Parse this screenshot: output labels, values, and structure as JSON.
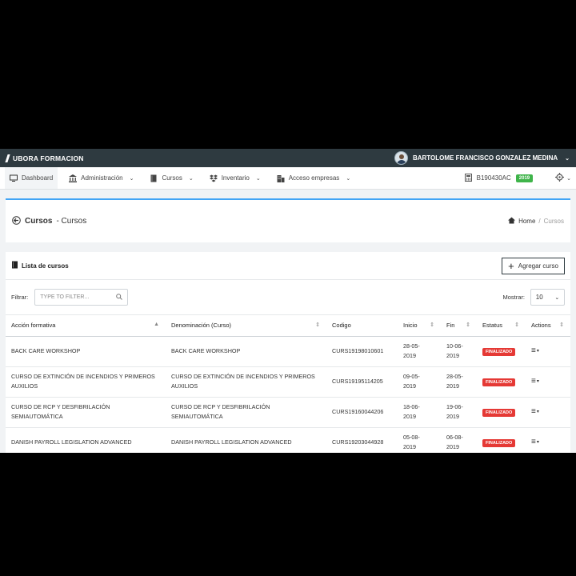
{
  "app": {
    "brand": "UBORA FORMACION",
    "user_name": "BARTOLOME FRANCISCO GONZALEZ MEDINA"
  },
  "nav": {
    "items": [
      {
        "label": "Dashboard",
        "icon": "monitor-icon",
        "chevron": false
      },
      {
        "label": "Administración",
        "icon": "bank-icon",
        "chevron": true
      },
      {
        "label": "Cursos",
        "icon": "book-icon",
        "chevron": true
      },
      {
        "label": "Inventario",
        "icon": "dropbox-icon",
        "chevron": true
      },
      {
        "label": "Acceso empresas",
        "icon": "building-icon",
        "chevron": true
      }
    ],
    "code": "B190430AC",
    "year": "2019"
  },
  "header": {
    "title_bold": "Cursos",
    "title_rest": "- Cursos",
    "breadcrumb_home": "Home",
    "breadcrumb_sep": "/",
    "breadcrumb_current": "Cursos"
  },
  "list": {
    "title": "Lista de cursos",
    "add_label": "Agregar curso",
    "filter_label": "Filtrar:",
    "filter_placeholder": "TYPE TO FILTER...",
    "show_label": "Mostrar:",
    "show_value": "10",
    "columns": [
      "Acción formativa",
      "Denominación (Curso)",
      "Codigo",
      "Inicio",
      "Fin",
      "Estatus",
      "Actions"
    ],
    "rows": [
      {
        "accion": "BACK CARE WORKSHOP",
        "denominacion": "BACK CARE WORKSHOP",
        "codigo": "CURS19198010601",
        "inicio_a": "28-05-",
        "inicio_b": "2019",
        "fin_a": "10-06-",
        "fin_b": "2019",
        "estatus": "FINALIZADO"
      },
      {
        "accion": "CURSO DE EXTINCIÓN DE INCENDIOS Y PRIMEROS AUXILIOS",
        "denominacion": "CURSO DE EXTINCIÓN DE INCENDIOS Y PRIMEROS AUXILIOS",
        "codigo": "CURS19195114205",
        "inicio_a": "09-05-",
        "inicio_b": "2019",
        "fin_a": "28-05-",
        "fin_b": "2019",
        "estatus": "FINALIZADO"
      },
      {
        "accion": "CURSO DE RCP Y DESFIBRILACIÓN SEMIAUTOMÁTICA",
        "denominacion": "CURSO DE RCP Y DESFIBRILACIÓN SEMIAUTOMÁTICA",
        "codigo": "CURS19160044206",
        "inicio_a": "18-06-",
        "inicio_b": "2019",
        "fin_a": "19-06-",
        "fin_b": "2019",
        "estatus": "FINALIZADO"
      },
      {
        "accion": "DANISH PAYROLL LEGISLATION ADVANCED",
        "denominacion": "DANISH PAYROLL LEGISLATION ADVANCED",
        "codigo": "CURS19203044928",
        "inicio_a": "05-08-",
        "inicio_b": "2019",
        "fin_a": "06-08-",
        "fin_b": "2019",
        "estatus": "FINALIZADO"
      }
    ]
  },
  "colors": {
    "topbar": "#2e3a40",
    "accent": "#42a5f5",
    "status_red": "#e53935",
    "year_green": "#3fb44a"
  }
}
